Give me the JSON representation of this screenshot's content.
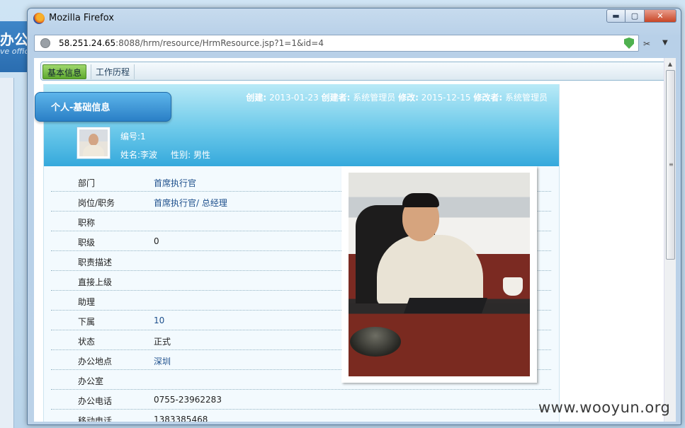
{
  "background_app": {
    "title": "办公",
    "subtitle": "ve offic"
  },
  "window": {
    "title": "Mozilla Firefox",
    "buttons": {
      "minimize": "▬",
      "maximize": "▢",
      "close": "✕"
    }
  },
  "urlbar": {
    "host": "58.251.24.65",
    "rest": ":8088/hrm/resource/HrmResource.jsp?1=1&id=4"
  },
  "tabs": [
    {
      "label": "基本信息",
      "active": true
    },
    {
      "label": "工作历程",
      "active": false
    }
  ],
  "section": {
    "title": "个人-基础信息",
    "meta": {
      "created_label": "创建:",
      "created": "2013-01-23",
      "creator_label": "创建者:",
      "creator": "系统管理员",
      "modified_label": "修改:",
      "modified": "2015-12-15",
      "modifier_label": "修改者:",
      "modifier": "系统管理员"
    },
    "id_line": "编号:1",
    "name_line": "姓名:李波",
    "gender_line": "性别: 男性"
  },
  "fields": [
    {
      "label": "部门",
      "value": "首席执行官",
      "link": true
    },
    {
      "label": "岗位/职务",
      "value": "首席执行官/ 总经理",
      "link": true
    },
    {
      "label": "职称",
      "value": ""
    },
    {
      "label": "职级",
      "value": "0"
    },
    {
      "label": "职责描述",
      "value": ""
    },
    {
      "label": "直接上级",
      "value": ""
    },
    {
      "label": "助理",
      "value": ""
    },
    {
      "label": "下属",
      "value": "10",
      "link": true
    },
    {
      "label": "状态",
      "value": "正式"
    },
    {
      "label": "办公地点",
      "value": "深圳",
      "link": true
    },
    {
      "label": "办公室",
      "value": ""
    },
    {
      "label": "办公电话",
      "value": "0755-23962283"
    },
    {
      "label": "移动电话",
      "value": "1383385468"
    }
  ],
  "watermark": "www.wooyun.org"
}
